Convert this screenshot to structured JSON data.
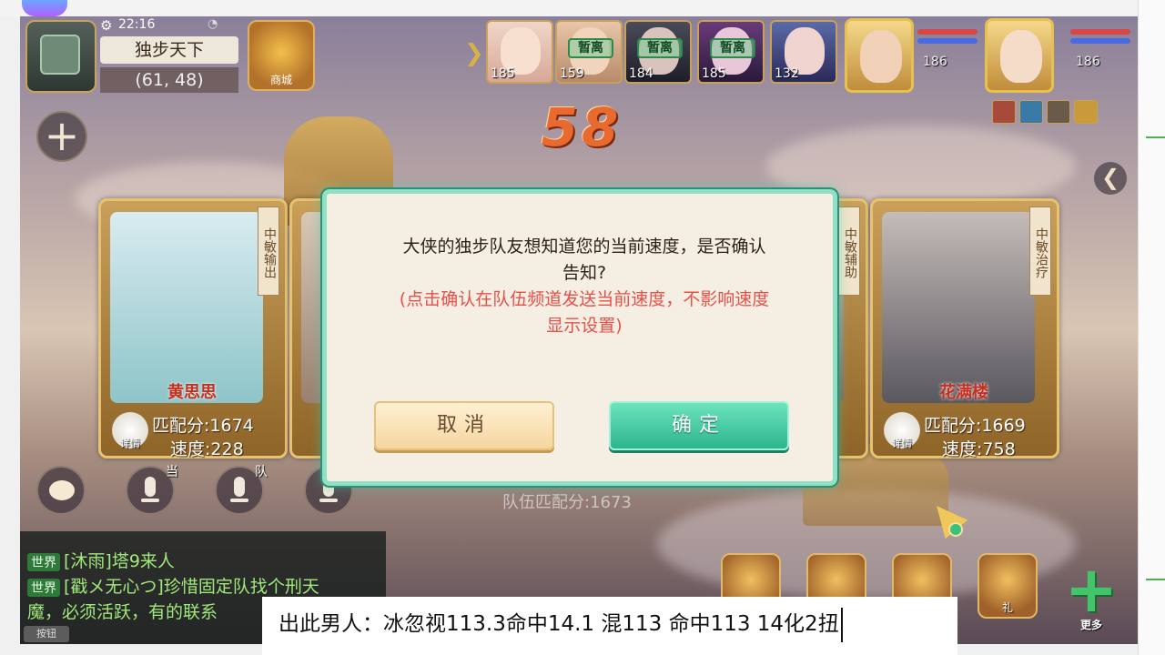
{
  "status": {
    "time": "22:16"
  },
  "location": {
    "map_name": "独步天下",
    "coords": "(61, 48)"
  },
  "countdown": "58",
  "party": {
    "members": [
      {
        "level": "185",
        "status": ""
      },
      {
        "level": "159",
        "status": "暂离"
      },
      {
        "level": "184",
        "status": "暂离"
      },
      {
        "level": "185",
        "status": "暂离"
      },
      {
        "level": "132",
        "status": ""
      }
    ],
    "leaders": [
      {
        "level": "186"
      },
      {
        "level": "186"
      }
    ]
  },
  "cards": [
    {
      "role": "中敏输出",
      "name": "黄思思",
      "score": "匹配分:1674",
      "speed": "速度:228",
      "detail": "详情"
    },
    {
      "role": "中敏辅助",
      "name": "",
      "score": "",
      "speed": "",
      "detail": ""
    },
    {
      "role": "中敏治疗",
      "name": "花满楼",
      "score": "匹配分:1669",
      "speed": "速度:758",
      "detail": "详情"
    }
  ],
  "voice": {
    "current_label": "当",
    "team_label": "队"
  },
  "team_total": "队伍匹配分:1673",
  "chat": {
    "lines": [
      {
        "channel": "世界",
        "text": "[沐雨]塔9来人"
      },
      {
        "channel": "世界",
        "text": "[戳メ无心つ]珍惜固定队找个刑天"
      },
      {
        "channel": "",
        "text": "魔，必须活跃，有的联系"
      }
    ],
    "button": "按钮"
  },
  "dialog": {
    "message": "大侠的独步队友想知道您的当前速度，是否确认告知?",
    "note": "(点击确认在队伍频道发送当前速度，不影响速度显示设置)",
    "cancel": "取消",
    "confirm": "确定"
  },
  "quick": {
    "more_label": "更多",
    "gift_label": "礼"
  },
  "subtitle": "出此男人：冰忽视113.3命中14.1  混113 命中113 14化2扭"
}
